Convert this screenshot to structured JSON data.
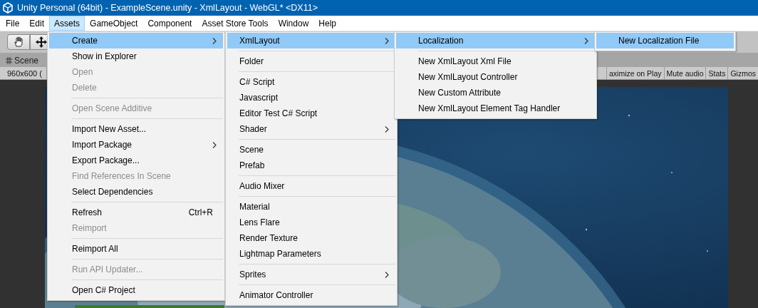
{
  "window": {
    "title": "Unity Personal (64bit) - ExampleScene.unity - XmlLayout - WebGL* <DX11>"
  },
  "menu_bar": [
    {
      "label": "File",
      "selected": false
    },
    {
      "label": "Edit",
      "selected": false
    },
    {
      "label": "Assets",
      "selected": true
    },
    {
      "label": "GameObject",
      "selected": false
    },
    {
      "label": "Component",
      "selected": false
    },
    {
      "label": "Asset Store Tools",
      "selected": false
    },
    {
      "label": "Window",
      "selected": false
    },
    {
      "label": "Help",
      "selected": false
    }
  ],
  "scene_tab": {
    "label": "Scene"
  },
  "game_toolbar": {
    "resolution": "960x600 (",
    "buttons": [
      "aximize on Play",
      "Mute audio",
      "Stats",
      "Gizmos"
    ]
  },
  "menus": [
    {
      "items": [
        {
          "kind": "item",
          "label": "Create",
          "selected": true,
          "disabled": false,
          "submenu": true
        },
        {
          "kind": "item",
          "label": "Show in Explorer",
          "selected": false,
          "disabled": false,
          "submenu": false
        },
        {
          "kind": "item",
          "label": "Open",
          "selected": false,
          "disabled": true,
          "submenu": false
        },
        {
          "kind": "item",
          "label": "Delete",
          "selected": false,
          "disabled": true,
          "submenu": false
        },
        {
          "kind": "separator"
        },
        {
          "kind": "item",
          "label": "Open Scene Additive",
          "selected": false,
          "disabled": true,
          "submenu": false
        },
        {
          "kind": "separator"
        },
        {
          "kind": "item",
          "label": "Import New Asset...",
          "selected": false,
          "disabled": false,
          "submenu": false
        },
        {
          "kind": "item",
          "label": "Import Package",
          "selected": false,
          "disabled": false,
          "submenu": true
        },
        {
          "kind": "item",
          "label": "Export Package...",
          "selected": false,
          "disabled": false,
          "submenu": false
        },
        {
          "kind": "item",
          "label": "Find References In Scene",
          "selected": false,
          "disabled": true,
          "submenu": false
        },
        {
          "kind": "item",
          "label": "Select Dependencies",
          "selected": false,
          "disabled": false,
          "submenu": false
        },
        {
          "kind": "separator"
        },
        {
          "kind": "item",
          "label": "Refresh",
          "shortcut": "Ctrl+R",
          "selected": false,
          "disabled": false,
          "submenu": false
        },
        {
          "kind": "item",
          "label": "Reimport",
          "selected": false,
          "disabled": true,
          "submenu": false
        },
        {
          "kind": "separator"
        },
        {
          "kind": "item",
          "label": "Reimport All",
          "selected": false,
          "disabled": false,
          "submenu": false
        },
        {
          "kind": "separator"
        },
        {
          "kind": "item",
          "label": "Run API Updater...",
          "selected": false,
          "disabled": true,
          "submenu": false
        },
        {
          "kind": "separator"
        },
        {
          "kind": "item",
          "label": "Open C# Project",
          "selected": false,
          "disabled": false,
          "submenu": false
        }
      ]
    },
    {
      "items": [
        {
          "kind": "item",
          "label": "XmlLayout",
          "selected": true,
          "disabled": false,
          "submenu": true
        },
        {
          "kind": "separator"
        },
        {
          "kind": "item",
          "label": "Folder",
          "selected": false,
          "disabled": false,
          "submenu": false
        },
        {
          "kind": "separator"
        },
        {
          "kind": "item",
          "label": "C# Script",
          "selected": false,
          "disabled": false,
          "submenu": false
        },
        {
          "kind": "item",
          "label": "Javascript",
          "selected": false,
          "disabled": false,
          "submenu": false
        },
        {
          "kind": "item",
          "label": "Editor Test C# Script",
          "selected": false,
          "disabled": false,
          "submenu": false
        },
        {
          "kind": "item",
          "label": "Shader",
          "selected": false,
          "disabled": false,
          "submenu": true
        },
        {
          "kind": "separator"
        },
        {
          "kind": "item",
          "label": "Scene",
          "selected": false,
          "disabled": false,
          "submenu": false
        },
        {
          "kind": "item",
          "label": "Prefab",
          "selected": false,
          "disabled": false,
          "submenu": false
        },
        {
          "kind": "separator"
        },
        {
          "kind": "item",
          "label": "Audio Mixer",
          "selected": false,
          "disabled": false,
          "submenu": false
        },
        {
          "kind": "separator"
        },
        {
          "kind": "item",
          "label": "Material",
          "selected": false,
          "disabled": false,
          "submenu": false
        },
        {
          "kind": "item",
          "label": "Lens Flare",
          "selected": false,
          "disabled": false,
          "submenu": false
        },
        {
          "kind": "item",
          "label": "Render Texture",
          "selected": false,
          "disabled": false,
          "submenu": false
        },
        {
          "kind": "item",
          "label": "Lightmap Parameters",
          "selected": false,
          "disabled": false,
          "submenu": false
        },
        {
          "kind": "separator"
        },
        {
          "kind": "item",
          "label": "Sprites",
          "selected": false,
          "disabled": false,
          "submenu": true
        },
        {
          "kind": "separator"
        },
        {
          "kind": "item",
          "label": "Animator Controller",
          "selected": false,
          "disabled": false,
          "submenu": false
        }
      ]
    },
    {
      "items": [
        {
          "kind": "item",
          "label": "Localization",
          "selected": true,
          "disabled": false,
          "submenu": true
        },
        {
          "kind": "separator"
        },
        {
          "kind": "item",
          "label": "New XmlLayout Xml File",
          "selected": false,
          "disabled": false,
          "submenu": false
        },
        {
          "kind": "item",
          "label": "New XmlLayout Controller",
          "selected": false,
          "disabled": false,
          "submenu": false
        },
        {
          "kind": "item",
          "label": "New Custom Attribute",
          "selected": false,
          "disabled": false,
          "submenu": false
        },
        {
          "kind": "item",
          "label": "New XmlLayout Element Tag Handler",
          "selected": false,
          "disabled": false,
          "submenu": false
        }
      ]
    },
    {
      "items": [
        {
          "kind": "item",
          "label": "New Localization File",
          "selected": true,
          "disabled": false,
          "submenu": false
        }
      ]
    }
  ]
}
